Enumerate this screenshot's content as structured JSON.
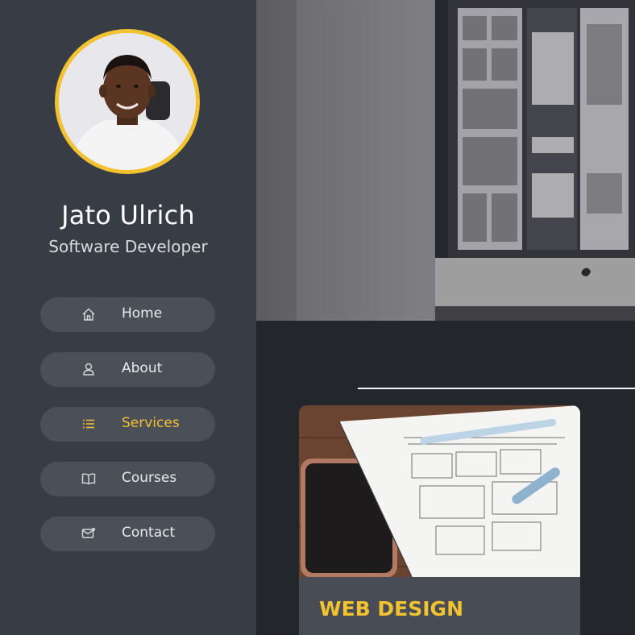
{
  "profile": {
    "name": "Jato Ulrich",
    "role": "Software Developer"
  },
  "nav": {
    "items": [
      {
        "label": "Home",
        "icon": "home-icon"
      },
      {
        "label": "About",
        "icon": "user-icon"
      },
      {
        "label": "Services",
        "icon": "list-icon",
        "active": true
      },
      {
        "label": "Courses",
        "icon": "book-icon"
      },
      {
        "label": "Contact",
        "icon": "mail-icon"
      }
    ]
  },
  "services": {
    "card_title": "WEB DESIGN"
  },
  "colors": {
    "accent": "#f2c230",
    "sidebar": "#383c44",
    "background": "#23262b"
  }
}
